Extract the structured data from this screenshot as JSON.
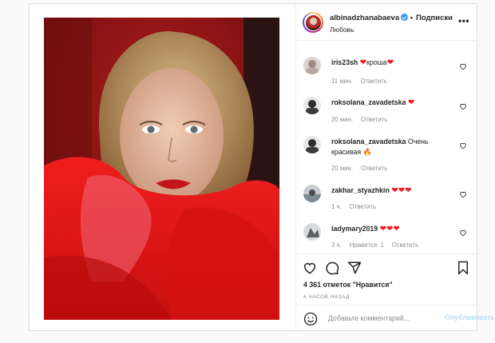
{
  "post": {
    "photo_alt": "",
    "header": {
      "username": "albinadzhanabaeva",
      "separator": "•",
      "follow_label": "Подписки",
      "location": "Любовь",
      "more_icon": "more-options-icon"
    },
    "comments": [
      {
        "user": "iris23sh",
        "pre": "",
        "hearts_before": "❤",
        "text": "кроша",
        "hearts_after": "❤",
        "time": "11 мин.",
        "reply": "Ответить",
        "likes": ""
      },
      {
        "user": "roksolana_zavadetska",
        "pre": "",
        "hearts_before": "",
        "text": "",
        "hearts_after": "❤",
        "time": "20 мин.",
        "reply": "Ответить",
        "likes": ""
      },
      {
        "user": "roksolana_zavadetska",
        "pre": "",
        "hearts_before": "",
        "text": "Очень красивая",
        "hearts_after": "🔥",
        "time": "20 мин.",
        "reply": "Ответить",
        "likes": ""
      },
      {
        "user": "zakhar_styazhkin",
        "pre": "",
        "hearts_before": "",
        "text": "",
        "hearts_after": "❤❤❤",
        "time": "1 ч.",
        "reply": "Ответить",
        "likes": ""
      },
      {
        "user": "ladymary2019",
        "pre": "",
        "hearts_before": "",
        "text": "",
        "hearts_after": "❤❤❤",
        "time": "3 ч.",
        "reply": "Ответить",
        "likes": "Нравится: 1"
      }
    ],
    "likes_text": "4 361 отметок \"Нравится\"",
    "time_ago": "4 ЧАСОВ НАЗАД",
    "comment_placeholder": "Добавьте комментарий...",
    "publish_label": "Опубликовать"
  },
  "colors": {
    "verified": "#3897f0",
    "heart": "#ed1c24",
    "publish_disabled": "#b2dffc",
    "meta": "#8e8e8e"
  }
}
